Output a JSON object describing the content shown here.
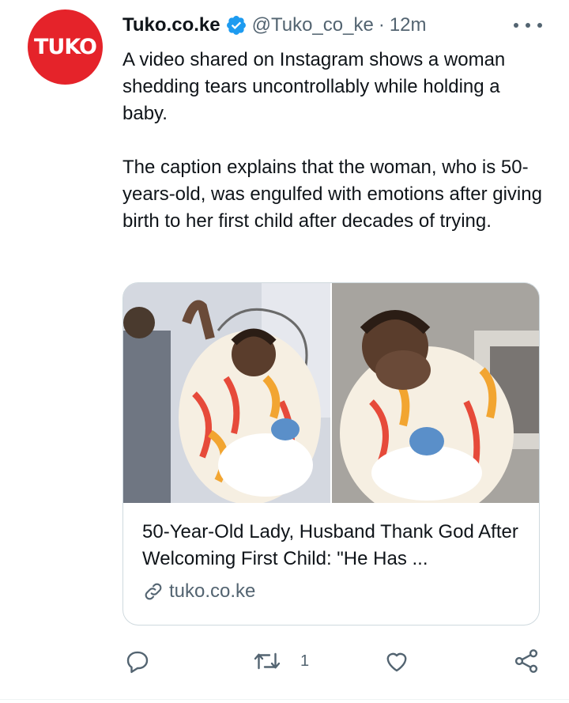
{
  "tweet": {
    "avatar_text": "TUKO",
    "author_name": "Tuko.co.ke",
    "handle": "@Tuko_co_ke",
    "separator": "·",
    "time": "12m",
    "text": "A video shared on Instagram shows a woman shedding tears uncontrollably while holding a baby.\n\nThe caption explains that the woman, who is 50-years-old, was engulfed with emotions after giving birth to her first child after decades of trying."
  },
  "card": {
    "title": "50-Year-Old Lady, Husband Thank God After Welcoming First Child: \"He Has ...",
    "domain": "tuko.co.ke"
  },
  "actions": {
    "retweet_count": "1"
  },
  "colors": {
    "brand_red": "#e5232a",
    "verified_blue": "#1d9bf0",
    "secondary_text": "#536471"
  }
}
